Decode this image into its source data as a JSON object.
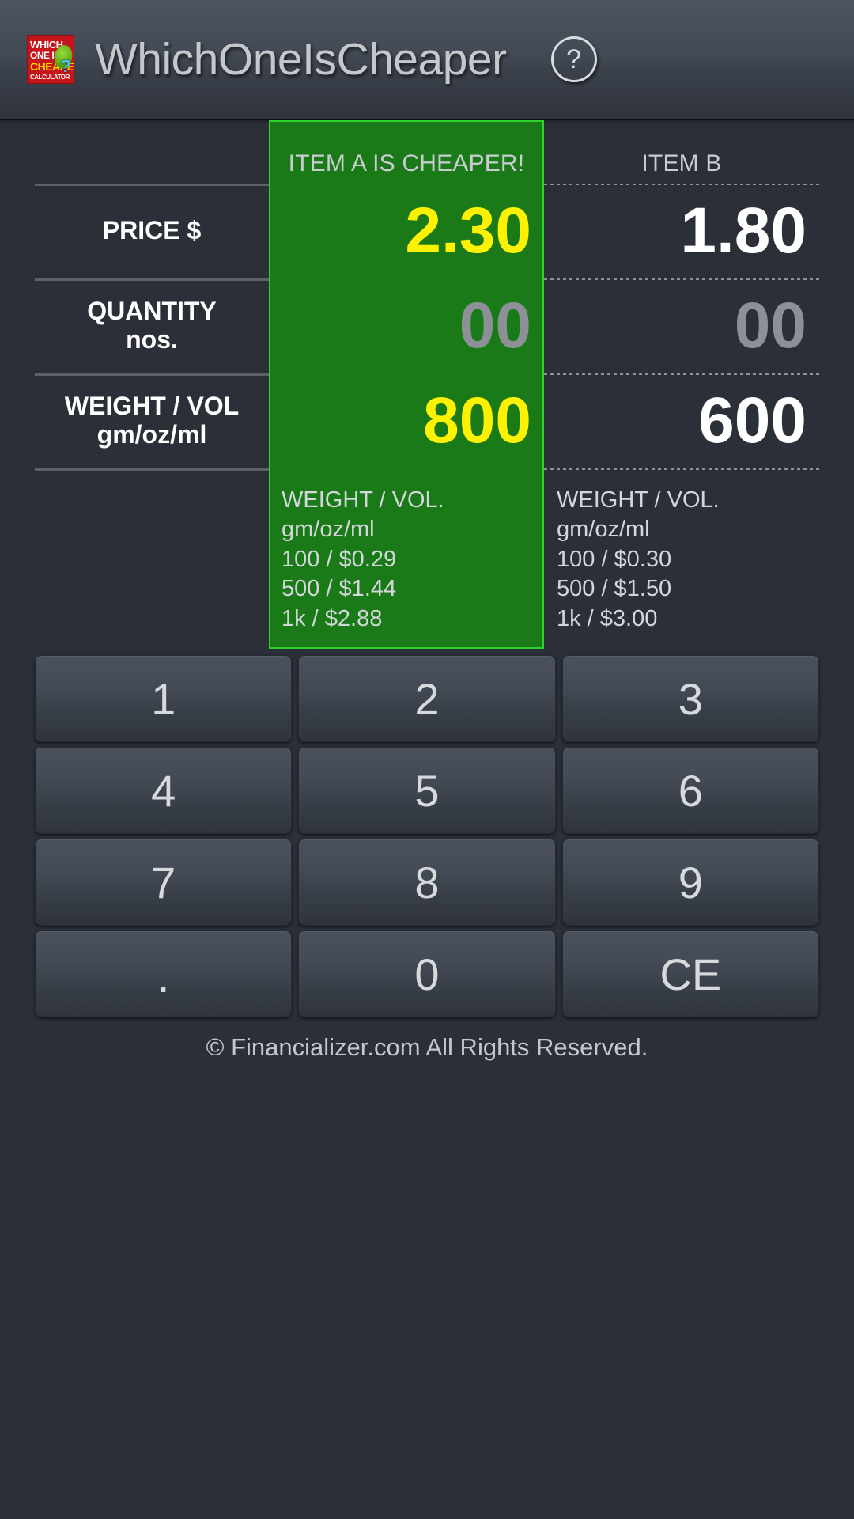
{
  "app": {
    "title": "WhichOneIsCheaper",
    "help_label": "?",
    "logo": {
      "line1": "WHICH",
      "line2": "ONE IS",
      "line3": "CHEAPER",
      "line4": "CALCULATOR",
      "question_mark": "?"
    }
  },
  "table": {
    "headers": {
      "blank": "",
      "item_a": "ITEM A IS CHEAPER!",
      "item_b": "ITEM B"
    },
    "rows": [
      {
        "label_main": "PRICE $",
        "label_sub": "",
        "a_value": "2.30",
        "a_state": "filled",
        "b_value": "1.80",
        "b_state": "filled"
      },
      {
        "label_main": "QUANTITY",
        "label_sub": "nos.",
        "a_value": "00",
        "a_state": "empty",
        "b_value": "00",
        "b_state": "empty"
      },
      {
        "label_main": "WEIGHT / VOL",
        "label_sub": "gm/oz/ml",
        "a_value": "800",
        "a_state": "filled",
        "b_value": "600",
        "b_state": "filled"
      }
    ],
    "detail": {
      "item_a": [
        "WEIGHT / VOL.",
        "gm/oz/ml",
        "100 / $0.29",
        "500 / $1.44",
        "1k / $2.88"
      ],
      "item_b": [
        "WEIGHT / VOL.",
        "gm/oz/ml",
        "100 / $0.30",
        "500 / $1.50",
        "1k / $3.00"
      ]
    }
  },
  "keypad": {
    "keys": [
      "1",
      "2",
      "3",
      "4",
      "5",
      "6",
      "7",
      "8",
      "9",
      ".",
      "0",
      "CE"
    ]
  },
  "footer": {
    "text": "© Financializer.com All Rights Reserved."
  },
  "colors": {
    "highlight_bg": "#1b7a18",
    "highlight_border": "#2dd32a",
    "value_yellow": "#fff200",
    "value_white": "#ffffff",
    "value_dim": "#8d9096",
    "app_bg": "#2b2f38"
  }
}
